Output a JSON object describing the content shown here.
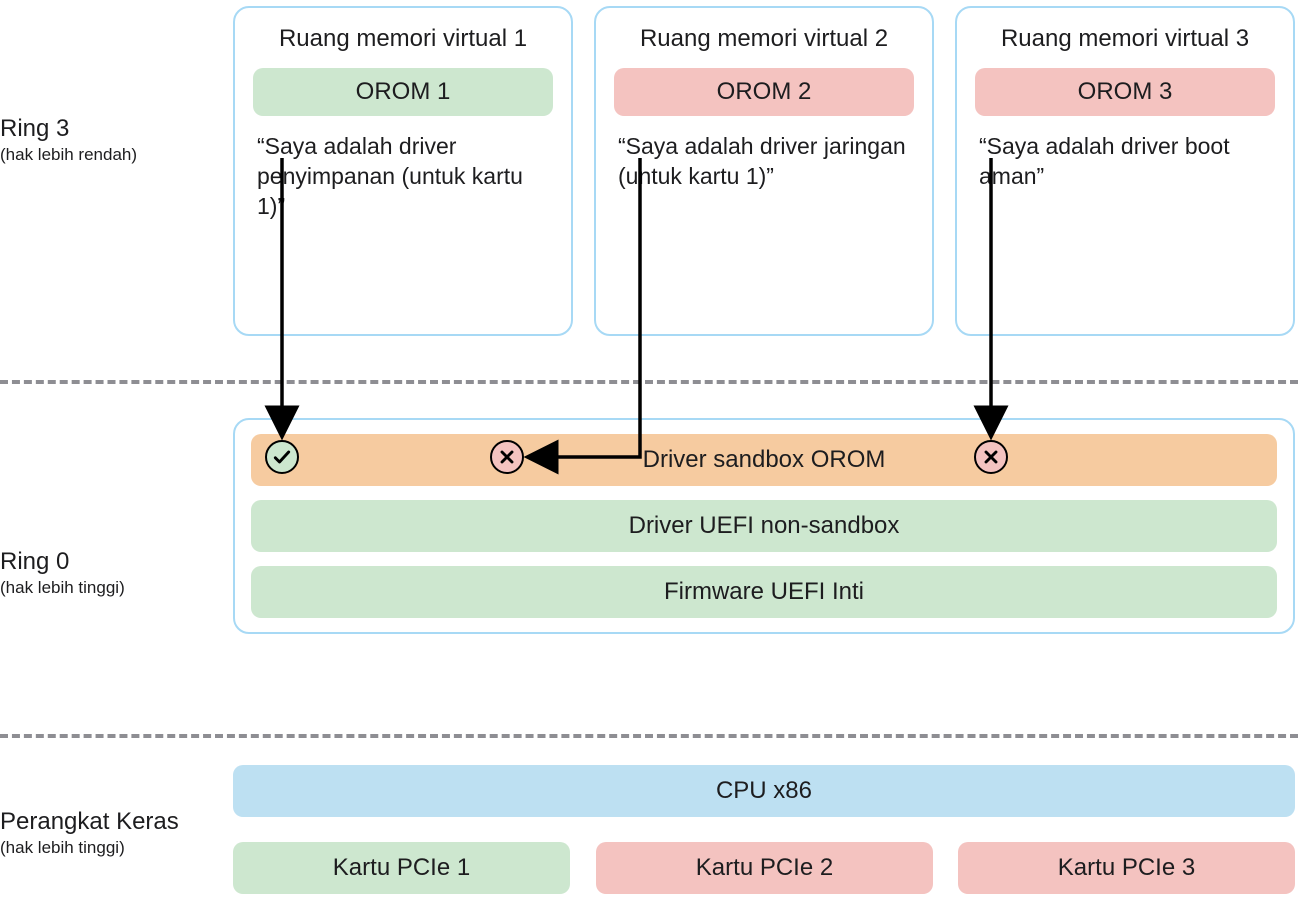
{
  "labels": {
    "ring3": {
      "title": "Ring 3",
      "sub": "(hak lebih rendah)"
    },
    "ring0": {
      "title": "Ring 0",
      "sub": "(hak lebih tinggi)"
    },
    "hw": {
      "title": "Perangkat Keras",
      "sub": "(hak lebih tinggi)"
    }
  },
  "vms": [
    {
      "title": "Ruang memori virtual 1",
      "orom": "OROM 1",
      "quote": "“Saya adalah driver penyimpanan (untuk kartu 1)”",
      "color": "green"
    },
    {
      "title": "Ruang memori virtual 2",
      "orom": "OROM 2",
      "quote": "“Saya adalah driver jaringan (untuk kartu 1)”",
      "color": "red"
    },
    {
      "title": "Ruang memori virtual 3",
      "orom": "OROM 3",
      "quote": "“Saya adalah driver boot aman”",
      "color": "red"
    }
  ],
  "ring0": {
    "sandbox": "Driver sandbox OROM",
    "nonsandbox": "Driver UEFI non-sandbox",
    "firmware": "Firmware UEFI Inti"
  },
  "hw": {
    "cpu": "CPU x86",
    "cards": [
      "Kartu PCIe 1",
      "Kartu PCIe 2",
      "Kartu PCIe 3"
    ]
  },
  "icons": {
    "check": "check-icon",
    "cross": "cross-icon"
  }
}
